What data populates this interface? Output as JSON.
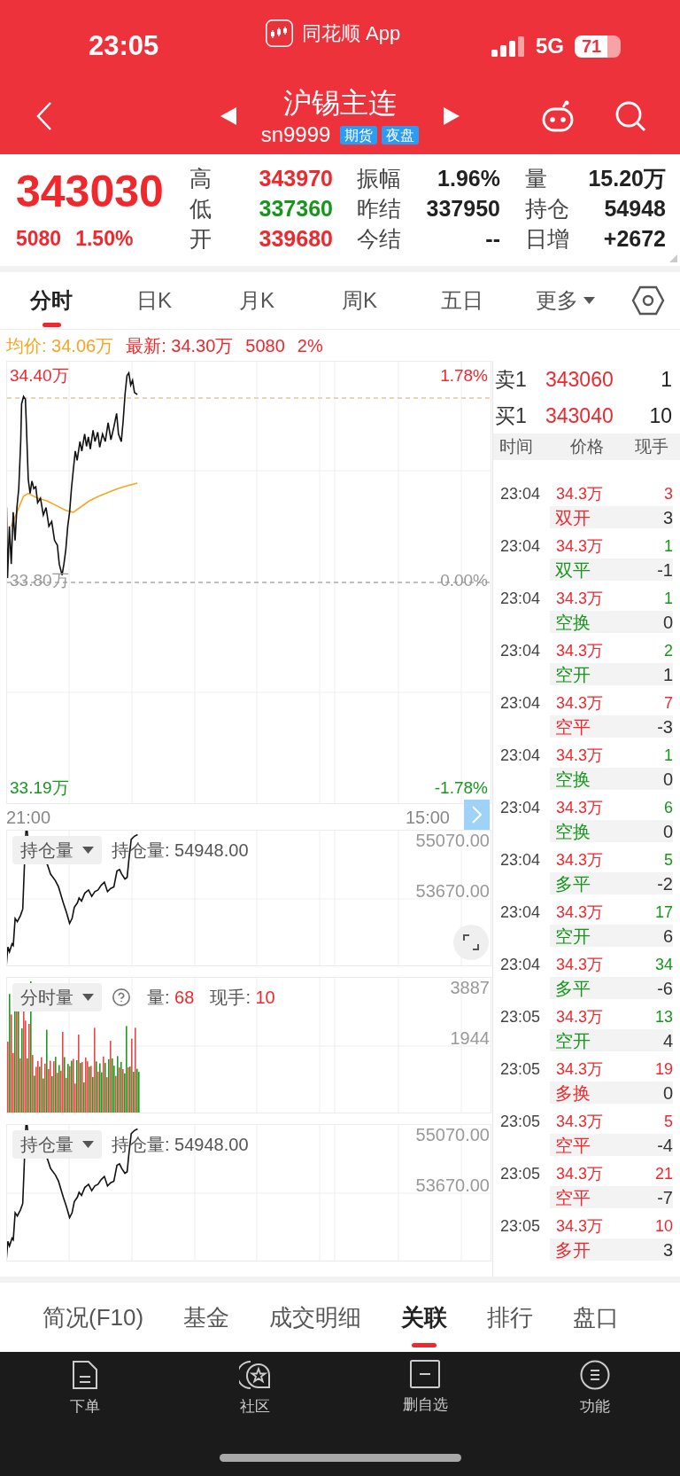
{
  "status_bar": {
    "time": "23:05",
    "app_label": "同花顺 App",
    "network": "5G",
    "battery": "71"
  },
  "header": {
    "title": "沪锡主连",
    "code": "sn9999",
    "tags": [
      "期货",
      "夜盘"
    ]
  },
  "quote": {
    "price": "343030",
    "change": "5080",
    "change_percent": "1.50%",
    "stats": [
      {
        "label": "高",
        "value": "343970",
        "color": "#f0282d"
      },
      {
        "label": "振幅",
        "value": "1.96%",
        "color": "#222222"
      },
      {
        "label": "量",
        "value": "15.20万",
        "color": "#222222"
      },
      {
        "label": "低",
        "value": "337360",
        "color": "#16961c"
      },
      {
        "label": "昨结",
        "value": "337950",
        "color": "#222222"
      },
      {
        "label": "持仓",
        "value": "54948",
        "color": "#222222"
      },
      {
        "label": "开",
        "value": "339680",
        "color": "#f0282d"
      },
      {
        "label": "今结",
        "value": "--",
        "color": "#222222"
      },
      {
        "label": "日增",
        "value": "+2672",
        "color": "#222222"
      }
    ]
  },
  "chart_tabs": [
    {
      "label": "分时",
      "selected": true,
      "kind": "tab"
    },
    {
      "label": "日K",
      "selected": false,
      "kind": "tab"
    },
    {
      "label": "月K",
      "selected": false,
      "kind": "tab"
    },
    {
      "label": "周K",
      "selected": false,
      "kind": "tab"
    },
    {
      "label": "五日",
      "selected": false,
      "kind": "tab"
    },
    {
      "label": "更多",
      "selected": false,
      "kind": "menu"
    }
  ],
  "summary": [
    {
      "text": "均价: 34.06万",
      "color": "#f5a623"
    },
    {
      "text": "最新: 34.30万",
      "color": "#f0282d"
    },
    {
      "text": "5080",
      "color": "#f0282d"
    },
    {
      "text": "2%",
      "color": "#f0282d"
    }
  ],
  "price_chart": {
    "left_labels": [
      {
        "text": "34.40万",
        "color": "#f0282d"
      },
      {
        "text": "33.80万",
        "color": "#999999"
      },
      {
        "text": "33.19万",
        "color": "#16961c"
      }
    ],
    "right_labels": [
      {
        "text": "1.78%",
        "color": "#f0282d"
      },
      {
        "text": "0.00%",
        "color": "#999999"
      },
      {
        "text": "-1.78%",
        "color": "#16961c"
      }
    ],
    "time_labels": [
      "21:00",
      "15:00"
    ]
  },
  "indicator_panels": [
    {
      "kind": "line",
      "selector": "持仓量",
      "expandable": true,
      "readings": [
        {
          "label": "持仓量:",
          "value": "54948.00",
          "color": "#555555"
        }
      ],
      "axis": [
        "55070.00",
        "53670.00"
      ]
    },
    {
      "kind": "bars",
      "selector": "分时量",
      "expandable": false,
      "readings": [
        {
          "label": "量:",
          "value": "68",
          "color": "#f0282d"
        },
        {
          "label": "现手:",
          "value": "10",
          "color": "#f0282d"
        }
      ],
      "axis": [
        "3887",
        "1944"
      ]
    },
    {
      "kind": "line",
      "selector": "持仓量",
      "expandable": false,
      "readings": [
        {
          "label": "持仓量:",
          "value": "54948.00",
          "color": "#555555"
        }
      ],
      "axis": [
        "55070.00",
        "53670.00"
      ]
    }
  ],
  "order_book": [
    {
      "label": "卖1",
      "price": "343060",
      "volume": "1"
    },
    {
      "label": "买1",
      "price": "343040",
      "volume": "10"
    }
  ],
  "trades": {
    "columns": [
      "时间",
      "价格",
      "现手"
    ],
    "rows": [
      {
        "time": "23:04",
        "price": "34.3万",
        "volume": "3",
        "type": "双开",
        "position_change": "3",
        "color": "#f0282d"
      },
      {
        "time": "23:04",
        "price": "34.3万",
        "volume": "1",
        "type": "双平",
        "position_change": "-1",
        "color": "#16961c"
      },
      {
        "time": "23:04",
        "price": "34.3万",
        "volume": "1",
        "type": "空换",
        "position_change": "0",
        "color": "#16961c"
      },
      {
        "time": "23:04",
        "price": "34.3万",
        "volume": "2",
        "type": "空开",
        "position_change": "1",
        "color": "#16961c"
      },
      {
        "time": "23:04",
        "price": "34.3万",
        "volume": "7",
        "type": "空平",
        "position_change": "-3",
        "color": "#f0282d"
      },
      {
        "time": "23:04",
        "price": "34.3万",
        "volume": "1",
        "type": "空换",
        "position_change": "0",
        "color": "#16961c"
      },
      {
        "time": "23:04",
        "price": "34.3万",
        "volume": "6",
        "type": "空换",
        "position_change": "0",
        "color": "#16961c"
      },
      {
        "time": "23:04",
        "price": "34.3万",
        "volume": "5",
        "type": "多平",
        "position_change": "-2",
        "color": "#16961c"
      },
      {
        "time": "23:04",
        "price": "34.3万",
        "volume": "17",
        "type": "空开",
        "position_change": "6",
        "color": "#16961c"
      },
      {
        "time": "23:04",
        "price": "34.3万",
        "volume": "34",
        "type": "多平",
        "position_change": "-6",
        "color": "#16961c"
      },
      {
        "time": "23:05",
        "price": "34.3万",
        "volume": "13",
        "type": "空开",
        "position_change": "4",
        "color": "#16961c"
      },
      {
        "time": "23:05",
        "price": "34.3万",
        "volume": "19",
        "type": "多换",
        "position_change": "0",
        "color": "#f0282d"
      },
      {
        "time": "23:05",
        "price": "34.3万",
        "volume": "5",
        "type": "空平",
        "position_change": "-4",
        "color": "#f0282d"
      },
      {
        "time": "23:05",
        "price": "34.3万",
        "volume": "21",
        "type": "空平",
        "position_change": "-7",
        "color": "#f0282d"
      },
      {
        "time": "23:05",
        "price": "34.3万",
        "volume": "10",
        "type": "多开",
        "position_change": "3",
        "color": "#f0282d"
      }
    ]
  },
  "bottom_tabs": [
    {
      "label": "简况(F10)",
      "selected": false
    },
    {
      "label": "基金",
      "selected": false
    },
    {
      "label": "成交明细",
      "selected": false
    },
    {
      "label": "关联",
      "selected": true
    },
    {
      "label": "排行",
      "selected": false
    },
    {
      "label": "盘口",
      "selected": false
    }
  ],
  "nav": [
    "下单",
    "社区",
    "删自选",
    "功能"
  ]
}
